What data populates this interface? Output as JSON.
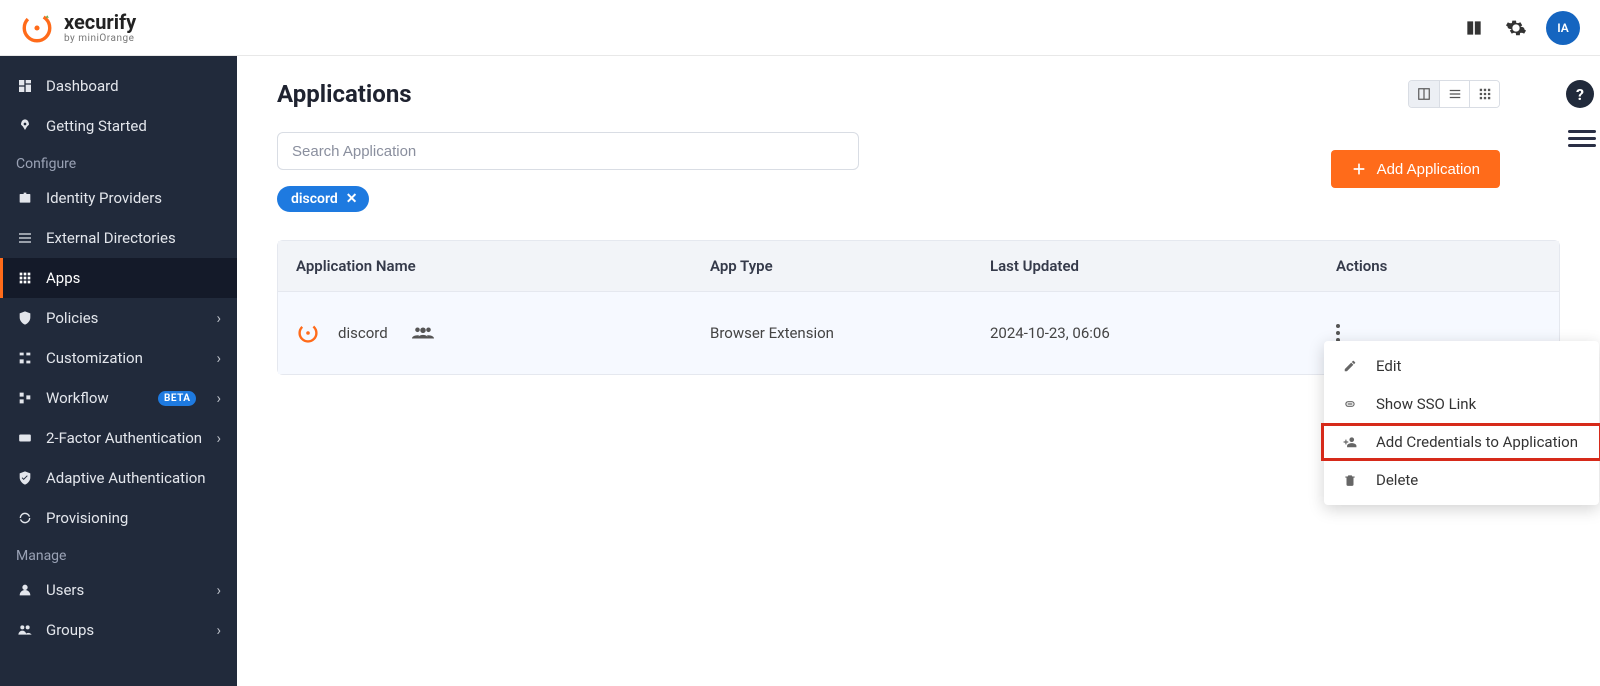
{
  "brand": {
    "name": "xecurify",
    "sub": "by miniOrange"
  },
  "avatar": "IA",
  "sidebar": {
    "items": [
      {
        "label": "Dashboard"
      },
      {
        "label": "Getting Started"
      }
    ],
    "section_configure": "Configure",
    "configure": [
      {
        "label": "Identity Providers"
      },
      {
        "label": "External Directories"
      },
      {
        "label": "Apps"
      },
      {
        "label": "Policies"
      },
      {
        "label": "Customization"
      },
      {
        "label": "Workflow",
        "badge": "BETA"
      },
      {
        "label": "2-Factor Authentication"
      },
      {
        "label": "Adaptive Authentication"
      },
      {
        "label": "Provisioning"
      }
    ],
    "section_manage": "Manage",
    "manage": [
      {
        "label": "Users"
      },
      {
        "label": "Groups"
      }
    ]
  },
  "page": {
    "title": "Applications",
    "search_placeholder": "Search Application",
    "add_button": "Add Application",
    "filter_chip": "discord",
    "columns": {
      "name": "Application Name",
      "type": "App Type",
      "updated": "Last Updated",
      "actions": "Actions"
    },
    "rows": [
      {
        "name": "discord",
        "type": "Browser Extension",
        "updated": "2024-10-23, 06:06"
      }
    ],
    "dropdown": {
      "edit": "Edit",
      "show_sso": "Show SSO Link",
      "add_creds": "Add Credentials to Application",
      "delete": "Delete"
    }
  }
}
